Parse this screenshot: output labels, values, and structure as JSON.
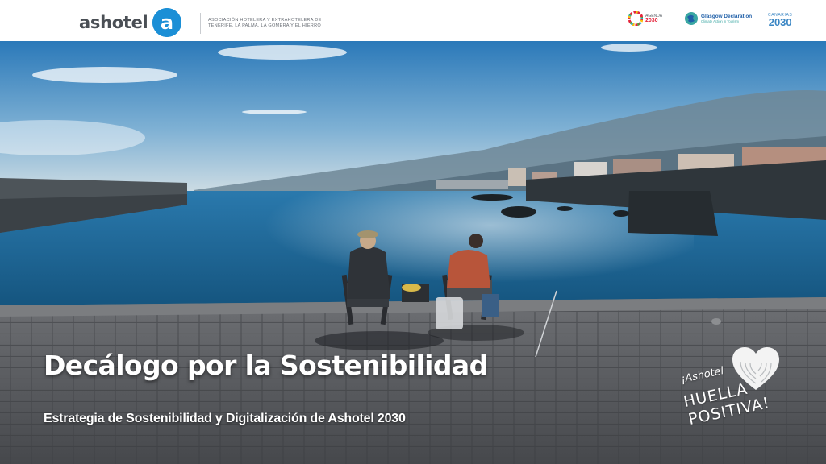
{
  "header": {
    "brand_name": "ashotel",
    "brand_letter": "a",
    "association_line1": "ASOCIACIÓN HOTELERA Y EXTRAHOTELERA DE",
    "association_line2": "TENERIFE, LA PALMA, LA GOMERA Y EL HIERRO",
    "partners": {
      "agenda_label": "AGENDA",
      "agenda_year": "2030",
      "glasgow_title": "Glasgow Declaration",
      "glasgow_subtitle": "Climate Action in Tourism",
      "canarias_label": "CANARIAS",
      "canarias_year": "2030"
    }
  },
  "hero": {
    "title": "Decálogo por la Sostenibilidad",
    "subtitle": "Estrategia de Sostenibilidad y Digitalización de Ashotel 2030",
    "badge": {
      "line1": "¡Ashotel",
      "line2": "HUELLA",
      "line3": "POSITIVA!"
    }
  },
  "colors": {
    "brand_blue": "#1b8fd6",
    "brand_grey": "#4a4f55",
    "sky_top": "#2f7fbf",
    "sea": "#1f6ea6",
    "pavement": "#5b5d61"
  },
  "icons": [
    "ashotel-logo-icon",
    "sdg-wheel-icon",
    "globe-icon",
    "heart-fingerprint-icon"
  ]
}
